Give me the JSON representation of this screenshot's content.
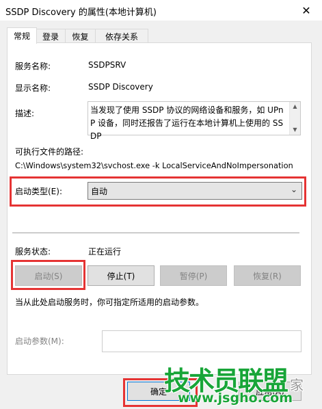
{
  "window": {
    "title": "SSDP Discovery 的属性(本地计算机)"
  },
  "tabs": [
    {
      "label": "常规"
    },
    {
      "label": "登录"
    },
    {
      "label": "恢复"
    },
    {
      "label": "依存关系"
    }
  ],
  "general": {
    "service_name_label": "服务名称:",
    "service_name": "SSDPSRV",
    "display_name_label": "显示名称:",
    "display_name": "SSDP Discovery",
    "description_label": "描述:",
    "description": "当发现了使用 SSDP 协议的网络设备和服务，如 UPnP 设备，同时还报告了运行在本地计算机上使用的 SSDP",
    "exec_path_label": "可执行文件的路径:",
    "exec_path": "C:\\Windows\\system32\\svchost.exe -k LocalServiceAndNoImpersonation",
    "startup_type_label": "启动类型(E):",
    "startup_type_value": "自动",
    "service_status_label": "服务状态:",
    "service_status": "正在运行",
    "buttons": {
      "start": "启动(S)",
      "stop": "停止(T)",
      "pause": "暂停(P)",
      "resume": "恢复(R)"
    },
    "hint": "当从此处启动服务时，你可指定所适用的启动参数。",
    "start_params_label": "启动参数(M):",
    "start_params_value": ""
  },
  "footer": {
    "ok": "确定",
    "apply": "应用(A)"
  },
  "watermark": {
    "logo": "技术员联盟",
    "url": "www.jsgho.com",
    "fragment": "家"
  },
  "colors": {
    "highlight": "#e53333",
    "watermark": "#18a538"
  }
}
